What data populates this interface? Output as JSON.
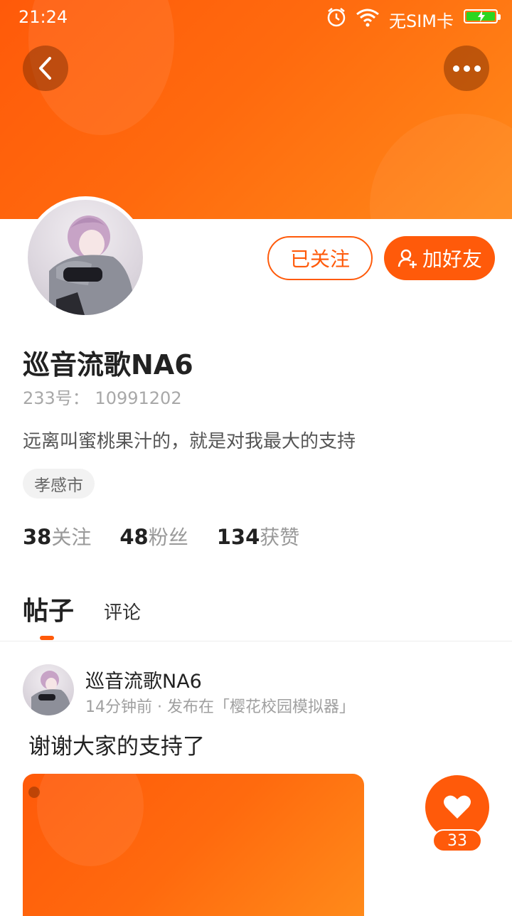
{
  "status_bar": {
    "time": "21:24",
    "carrier": "无SIM卡",
    "battery_color": "#2bd61f"
  },
  "header": {
    "back_icon": "chevron-left-icon",
    "more_icon": "more-dots-icon",
    "accent": "#ff5a0a"
  },
  "profile": {
    "username": "巡音流歌NA6",
    "id_text": "233号：  10991202",
    "bio": "远离叫蜜桃果汁的，就是对我最大的支持",
    "location_tag": "孝感市",
    "follow_button": "已关注",
    "add_friend_button": "加好友",
    "stats": [
      {
        "num": "38",
        "label": "关注"
      },
      {
        "num": "48",
        "label": "粉丝"
      },
      {
        "num": "134",
        "label": "获赞"
      }
    ]
  },
  "tabs": {
    "active": "帖子",
    "other": "评论"
  },
  "post": {
    "author": "巡音流歌NA6",
    "meta": "14分钟前 · 发布在「樱花校园模拟器」",
    "text": "谢谢大家的支持了",
    "like_count": "33"
  }
}
